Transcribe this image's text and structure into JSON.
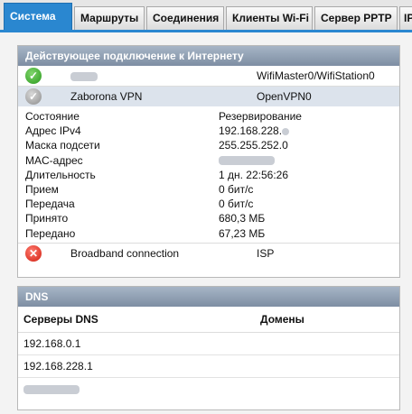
{
  "tabs": [
    {
      "label": "Система"
    },
    {
      "label": "Маршруты"
    },
    {
      "label": "Соединения"
    },
    {
      "label": "Клиенты Wi-Fi"
    },
    {
      "label": "Сервер PPTP"
    },
    {
      "label": "IP"
    }
  ],
  "internet_panel": {
    "title": "Действующее подключение к Интернету",
    "connections": [
      {
        "name": "",
        "interface": "WifiMaster0/WifiStation0",
        "status_icon": "check-icon"
      },
      {
        "name": "Zaborona VPN",
        "interface": "OpenVPN0",
        "status_icon": "check-icon-gray"
      }
    ],
    "details": [
      {
        "label": "Состояние",
        "value": "Резервирование"
      },
      {
        "label": "Адрес IPv4",
        "value": "192.168.228."
      },
      {
        "label": "Маска подсети",
        "value": "255.255.252.0"
      },
      {
        "label": "MAC-адрес",
        "value": ""
      },
      {
        "label": "Длительность",
        "value": "1 дн. 22:56:26"
      },
      {
        "label": "Прием",
        "value": "0 бит/с"
      },
      {
        "label": "Передача",
        "value": "0 бит/с"
      },
      {
        "label": "Принято",
        "value": "680,3 МБ"
      },
      {
        "label": "Передано",
        "value": "67,23 МБ"
      }
    ],
    "broadband": {
      "name": "Broadband connection",
      "interface": "ISP",
      "status_icon": "error-icon"
    }
  },
  "dns_panel": {
    "title": "DNS",
    "col_servers": "Серверы DNS",
    "col_domains": "Домены",
    "servers": [
      "192.168.0.1",
      "192.168.228.1",
      ""
    ]
  }
}
